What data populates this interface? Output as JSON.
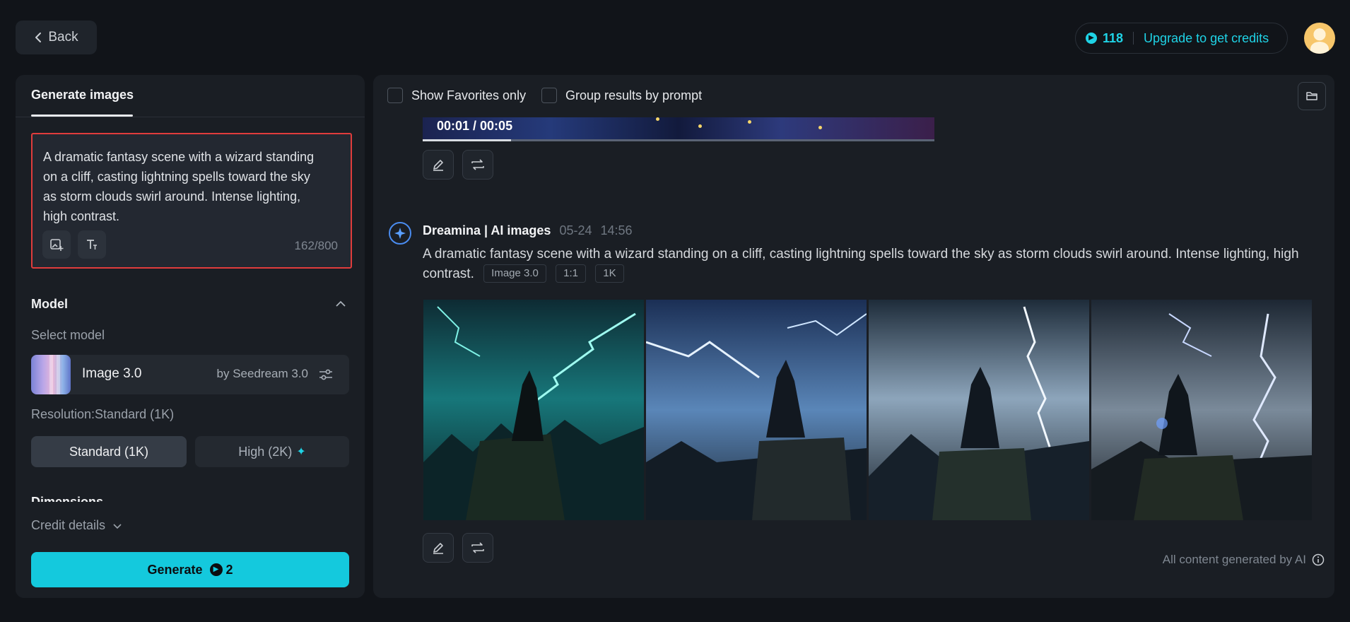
{
  "topbar": {
    "back_label": "Back",
    "credits_count": "118",
    "upgrade_label": "Upgrade to get credits"
  },
  "left_panel": {
    "tab_label": "Generate images",
    "prompt_text": "A dramatic fantasy scene with a wizard standing on a cliff, casting lightning spells toward the sky as storm clouds swirl around. Intense lighting, high contrast.",
    "char_count": "162/800",
    "model_section_title": "Model",
    "select_model_label": "Select model",
    "model_name": "Image 3.0",
    "model_by": "by Seedream 3.0",
    "resolution_label": "Resolution:Standard (1K)",
    "res_standard_label": "Standard (1K)",
    "res_high_label": "High (2K)",
    "dimensions_title": "Dimensions",
    "credit_details_label": "Credit details",
    "generate_label": "Generate",
    "generate_cost": "2"
  },
  "right_panel": {
    "show_favorites_label": "Show Favorites only",
    "group_by_prompt_label": "Group results by prompt",
    "video_time": "00:01 / 00:05",
    "generation": {
      "source": "Dreamina | AI images",
      "date": "05-24",
      "time": "14:56",
      "prompt": "A dramatic fantasy scene with a wizard standing on a cliff, casting lightning spells toward the sky as storm clouds swirl around. Intense lighting, high contrast.",
      "tags": [
        "Image 3.0",
        "1:1",
        "1K"
      ]
    },
    "ai_note": "All content generated by AI"
  },
  "colors": {
    "accent": "#14c9dd",
    "background": "#111419",
    "panel": "#1a1e24",
    "highlight_border": "#e03c3c"
  },
  "icons": [
    "chevron-left-icon",
    "coin-icon",
    "image-add-icon",
    "text-size-icon",
    "chevron-up-icon",
    "settings-sliders-icon",
    "sparkle-icon",
    "chevron-down-icon",
    "folder-icon",
    "edit-pencil-icon",
    "regenerate-icon",
    "dreamina-logo-icon",
    "info-icon"
  ]
}
